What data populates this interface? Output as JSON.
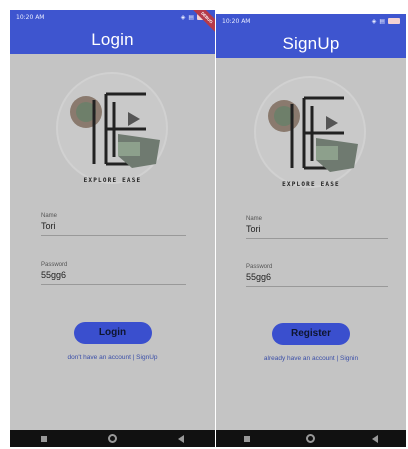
{
  "login_screen": {
    "status_time": "10:20 AM",
    "status_icons": [
      "location-icon",
      "clock-icon",
      "data-icon",
      "tenor-icon"
    ],
    "debug_label": "DEBUG",
    "title": "Login",
    "logo_text": "EXPLORE EASE",
    "name_label": "Name",
    "name_value": "Tori",
    "password_label": "Password",
    "password_value": "55gg6",
    "button_label": "Login",
    "link_text": "don't have an account | SignUp"
  },
  "signup_screen": {
    "status_time": "10:20 AM",
    "title": "SignUp",
    "logo_text": "EXPLORE EASE",
    "name_label": "Name",
    "name_value": "Tori",
    "password_label": "Password",
    "password_value": "55gg6",
    "button_label": "Register",
    "link_text": "already have an account | Signin"
  },
  "colors": {
    "appbar": "#3e55cf",
    "background": "#c4c4c4",
    "button": "#3a4fce",
    "link": "#3b4fa8",
    "navbar": "#111111"
  }
}
